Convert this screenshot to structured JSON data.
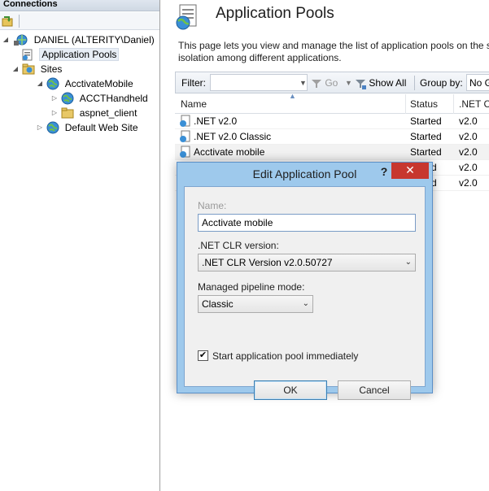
{
  "connections": {
    "header": "Connections",
    "tree": [
      {
        "label": "DANIEL (ALTERITY\\Daniel)",
        "expander": "◢",
        "icon": "server-icon"
      },
      {
        "label": "Application Pools",
        "expander": "",
        "icon": "app-pools-icon"
      },
      {
        "label": "Sites",
        "expander": "◢",
        "icon": "sites-folder-icon"
      },
      {
        "label": "AcctivateMobile",
        "expander": "◢",
        "icon": "globe-icon"
      },
      {
        "label": "ACCTHandheld",
        "expander": "▷",
        "icon": "globe-icon"
      },
      {
        "label": "aspnet_client",
        "expander": "▷",
        "icon": "folder-icon"
      },
      {
        "label": "Default Web Site",
        "expander": "▷",
        "icon": "globe-icon"
      }
    ]
  },
  "main": {
    "title": "Application Pools",
    "description": "This page lets you view and manage the list of application pools on the s isolation among different applications.",
    "filter_bar": {
      "filter_label": "Filter:",
      "filter_value": "",
      "go_label": "Go",
      "show_all_label": "Show All",
      "group_by_label": "Group by:",
      "group_by_value": "No G"
    },
    "grid": {
      "columns": [
        "Name",
        "Status",
        ".NET CL"
      ],
      "rows": [
        {
          "name": ".NET v2.0",
          "status": "Started",
          "clr": "v2.0"
        },
        {
          "name": ".NET v2.0 Classic",
          "status": "Started",
          "clr": "v2.0"
        },
        {
          "name": "Acctivate mobile",
          "status": "Started",
          "clr": "v2.0"
        },
        {
          "name": "",
          "status": "ted",
          "clr": "v2.0"
        },
        {
          "name": "",
          "status": "ted",
          "clr": "v2.0"
        }
      ]
    }
  },
  "dialog": {
    "title": "Edit Application Pool",
    "help": "?",
    "close": "✕",
    "name_label": "Name:",
    "name_value": "Acctivate mobile",
    "clr_label": ".NET CLR version:",
    "clr_value": ".NET CLR Version v2.0.50727",
    "pipeline_label": "Managed pipeline mode:",
    "pipeline_value": "Classic",
    "start_checked": true,
    "start_label": "Start application pool immediately",
    "ok_label": "OK",
    "cancel_label": "Cancel"
  },
  "colors": {
    "dialog_frame": "#9ec9ec",
    "close_button": "#c7372f",
    "selected_row": "#f2f2f2"
  }
}
